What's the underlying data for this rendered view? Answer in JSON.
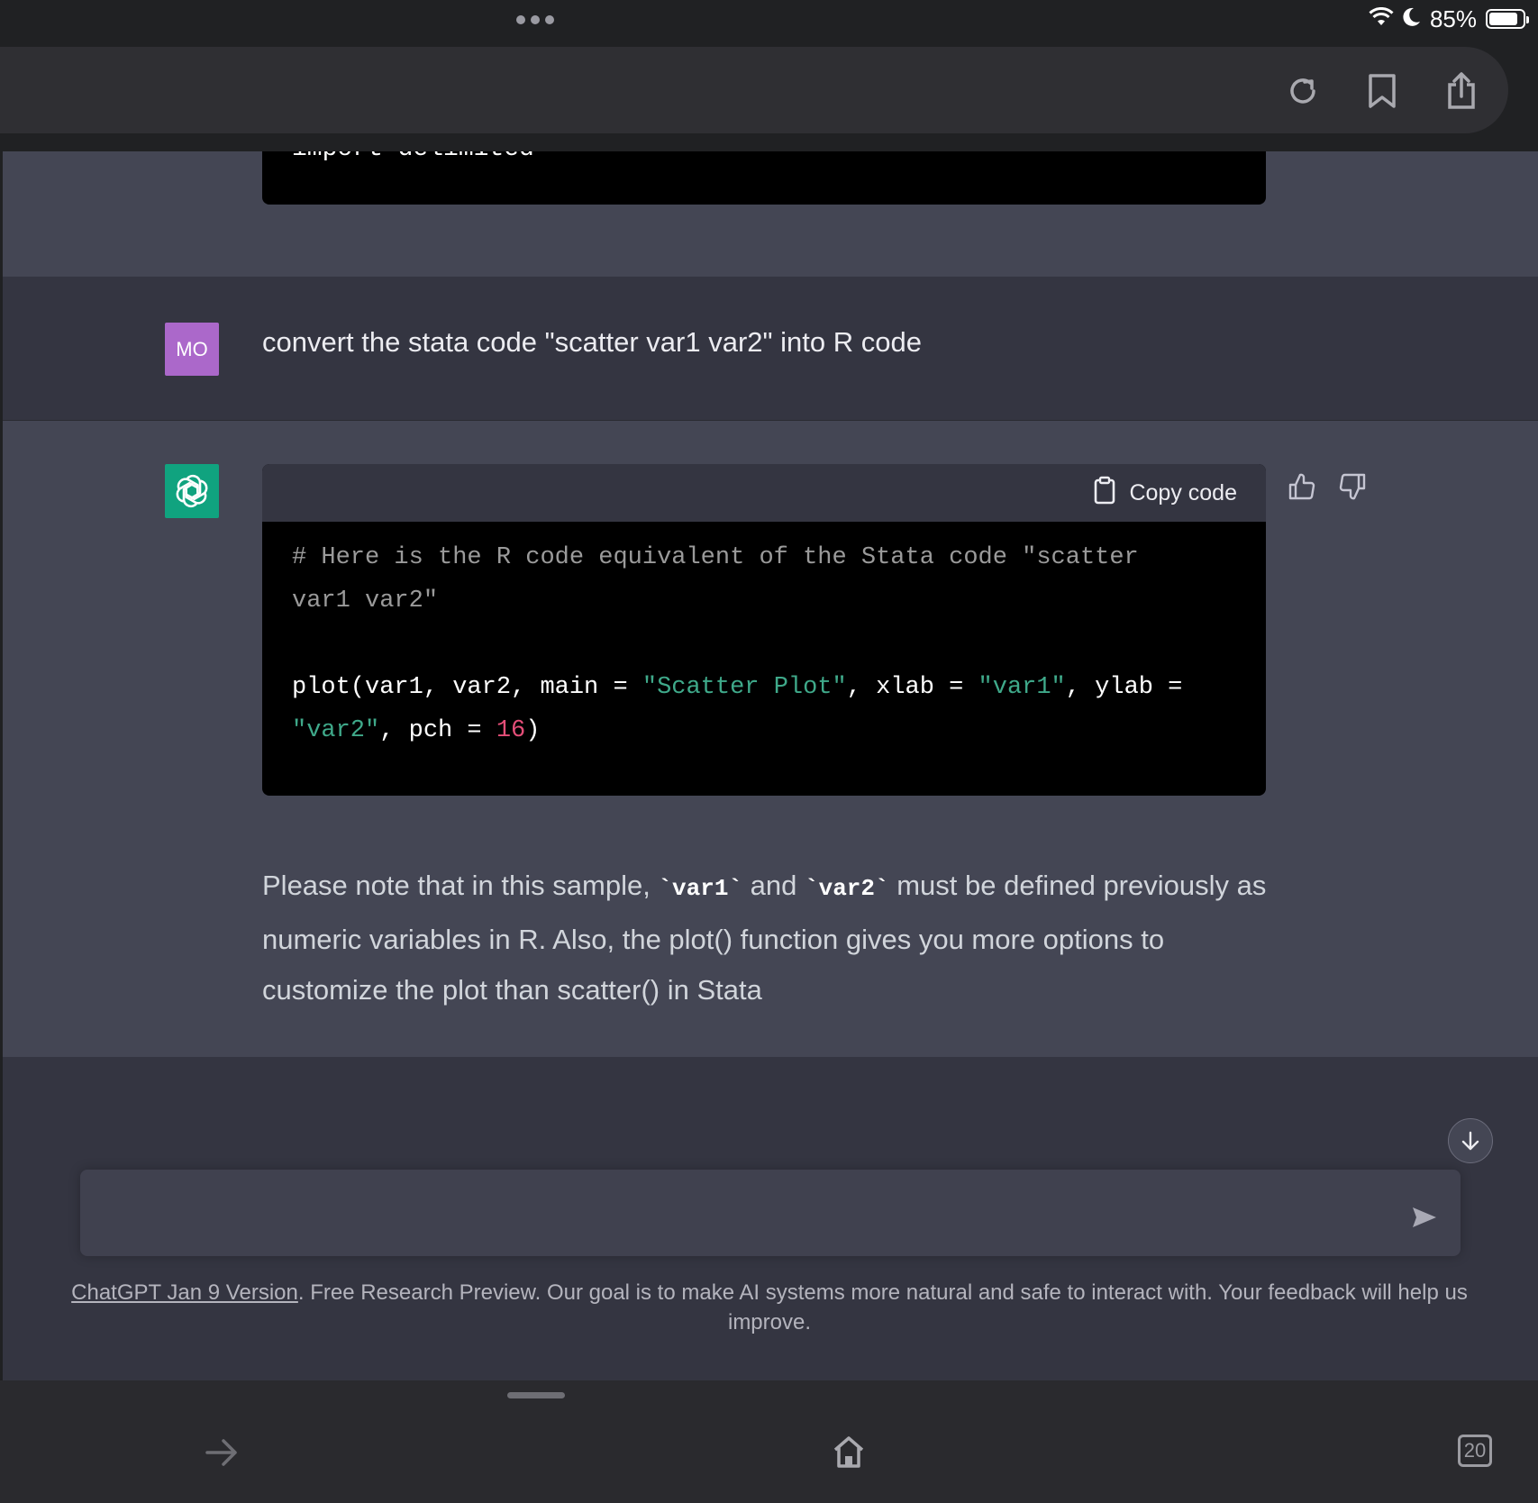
{
  "status_bar": {
    "battery": "85%",
    "battery_level": 0.85
  },
  "browser": {
    "buttons": [
      "reload-icon",
      "bookmark-icon",
      "share-icon"
    ]
  },
  "conversation": {
    "previous_code_tail": "import delimited",
    "user_message": {
      "avatar_initials": "MO",
      "text": "convert the stata code \"scatter var1 var2\" into R code"
    },
    "assistant_message": {
      "copy_label": "Copy code",
      "code_lines": [
        "# Here is the R code equivalent of the Stata code \"scatter",
        "var1 var2\"",
        "",
        "plot(var1, var2, main = \"Scatter Plot\", xlab = \"var1\", ylab =",
        "\"var2\", pch = 16)"
      ],
      "note_pre": "Please note that in this sample, ",
      "note_code1": "`var1`",
      "note_mid": " and ",
      "note_code2": "`var2`",
      "note_post": " must be defined previously as numeric variables in R. Also, the plot() function gives you more options to customize the plot than scatter() in Stata"
    }
  },
  "composer": {
    "placeholder": ""
  },
  "footer": {
    "link_text": "ChatGPT Jan 9 Version",
    "text": ". Free Research Preview. Our goal is to make AI systems more natural and safe to interact with. Your feedback will help us improve."
  },
  "toolbar": {
    "tab_count": "20"
  }
}
